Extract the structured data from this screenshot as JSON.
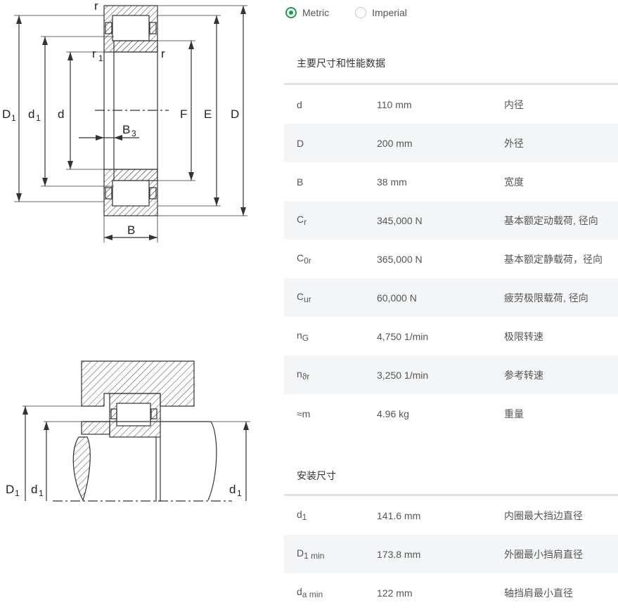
{
  "drawings": {
    "top": {
      "labels": {
        "r_top": "r",
        "r1": "r",
        "r1_sub": "1",
        "r_right": "r",
        "D1": "D",
        "D1_sub": "1",
        "d1": "d",
        "d1_sub": "1",
        "d": "d",
        "B3": "B",
        "B3_sub": "3",
        "F": "F",
        "E": "E",
        "D": "D",
        "B": "B"
      }
    },
    "bottom": {
      "labels": {
        "D1": "D",
        "D1_sub": "1",
        "d1_left": "d",
        "d1_left_sub": "1",
        "d1_right": "d",
        "d1_right_sub": "1"
      }
    }
  },
  "units": {
    "options": [
      "Metric",
      "Imperial"
    ],
    "selected": "Metric"
  },
  "sections": [
    {
      "title": "主要尺寸和性能数据",
      "rows": [
        {
          "sym": "d",
          "sub": "",
          "value": "110 mm",
          "desc": "内径"
        },
        {
          "sym": "D",
          "sub": "",
          "value": "200 mm",
          "desc": "外径"
        },
        {
          "sym": "B",
          "sub": "",
          "value": "38 mm",
          "desc": "宽度"
        },
        {
          "sym": "C",
          "sub": "r",
          "value": "345,000 N",
          "desc": "基本额定动载荷, 径向"
        },
        {
          "sym": "C",
          "sub": "0r",
          "value": "365,000 N",
          "desc": "基本额定静载荷，径向"
        },
        {
          "sym": "C",
          "sub": "ur",
          "value": "60,000 N",
          "desc": "疲劳极限载荷, 径向"
        },
        {
          "sym": "n",
          "sub": "G",
          "value": "4,750 1/min",
          "desc": "极限转速"
        },
        {
          "sym": "n",
          "sub": "ϑr",
          "value": "3,250 1/min",
          "desc": "参考转速"
        },
        {
          "sym": "≈m",
          "sub": "",
          "value": "4.96 kg",
          "desc": "重量"
        }
      ]
    },
    {
      "title": "安装尺寸",
      "rows": [
        {
          "sym": "d",
          "sub": "1",
          "value": "141.6 mm",
          "desc": "内圈最大挡边直径"
        },
        {
          "sym": "D",
          "sub": "1 min",
          "value": "173.8 mm",
          "desc": "外圈最小挡肩直径"
        },
        {
          "sym": "d",
          "sub": "a min",
          "value": "122 mm",
          "desc": "轴挡肩最小直径"
        }
      ]
    }
  ]
}
